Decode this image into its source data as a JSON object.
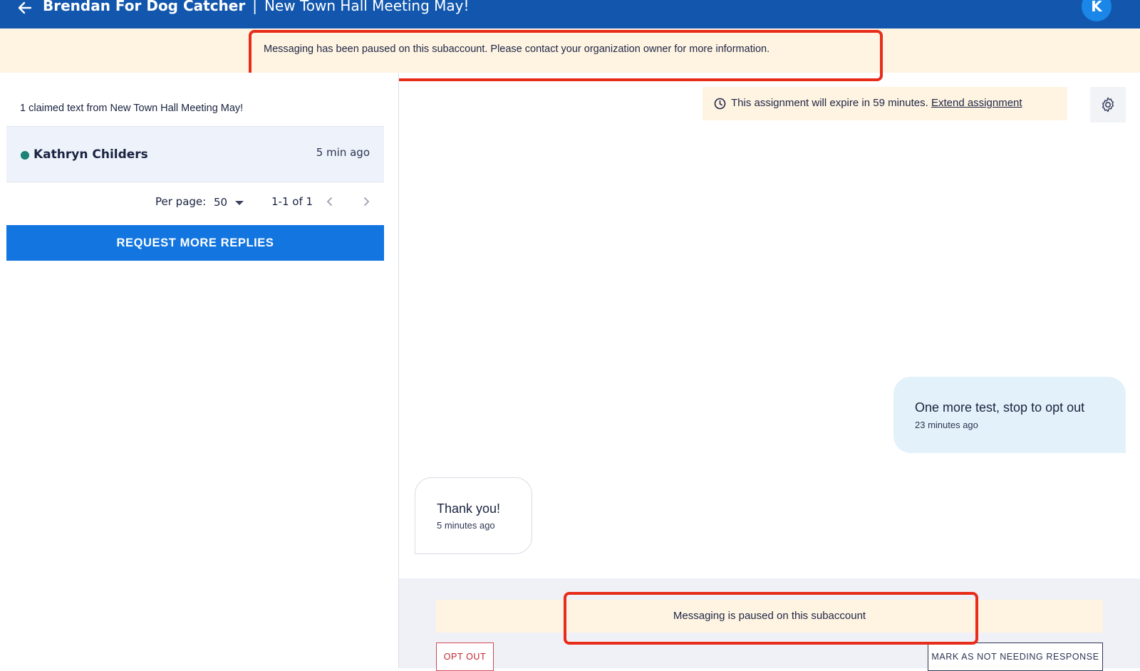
{
  "header": {
    "org_name": "Brendan For Dog Catcher",
    "separator": "|",
    "campaign_name": "New Town Hall Meeting May!",
    "avatar_initial": "K",
    "back_icon": "arrow-left-icon"
  },
  "banner": {
    "message": "Messaging has been paused on this subaccount. Please contact your organization owner for more information."
  },
  "sidebar": {
    "claimed_text": "1 claimed text from New Town Hall Meeting May!",
    "contacts": [
      {
        "name": "Kathryn Childers",
        "time": "5 min ago",
        "status_color": "#177f74"
      }
    ],
    "pagination": {
      "per_page_label": "Per page:",
      "per_page_value": "50",
      "range": "1-1 of 1"
    },
    "request_button": "REQUEST MORE REPLIES"
  },
  "conversation": {
    "assignment_notice": "This assignment will expire in 59 minutes.",
    "extend_link": "Extend assignment",
    "messages": [
      {
        "direction": "outgoing",
        "body": "One more test, stop to opt out",
        "time": "23 minutes ago"
      },
      {
        "direction": "incoming",
        "body": "Thank you!",
        "time": "5 minutes ago"
      }
    ],
    "paused_notice": "Messaging is paused on this subaccount",
    "opt_out_button": "OPT OUT",
    "mark_button": "MARK AS NOT NEEDING RESPONSE"
  },
  "colors": {
    "header_bg": "#1257ad",
    "primary_button": "#1275e0",
    "notice_bg": "#fff3e2",
    "highlight": "#e82c1a",
    "outgoing_bubble": "#e3f2fa"
  }
}
